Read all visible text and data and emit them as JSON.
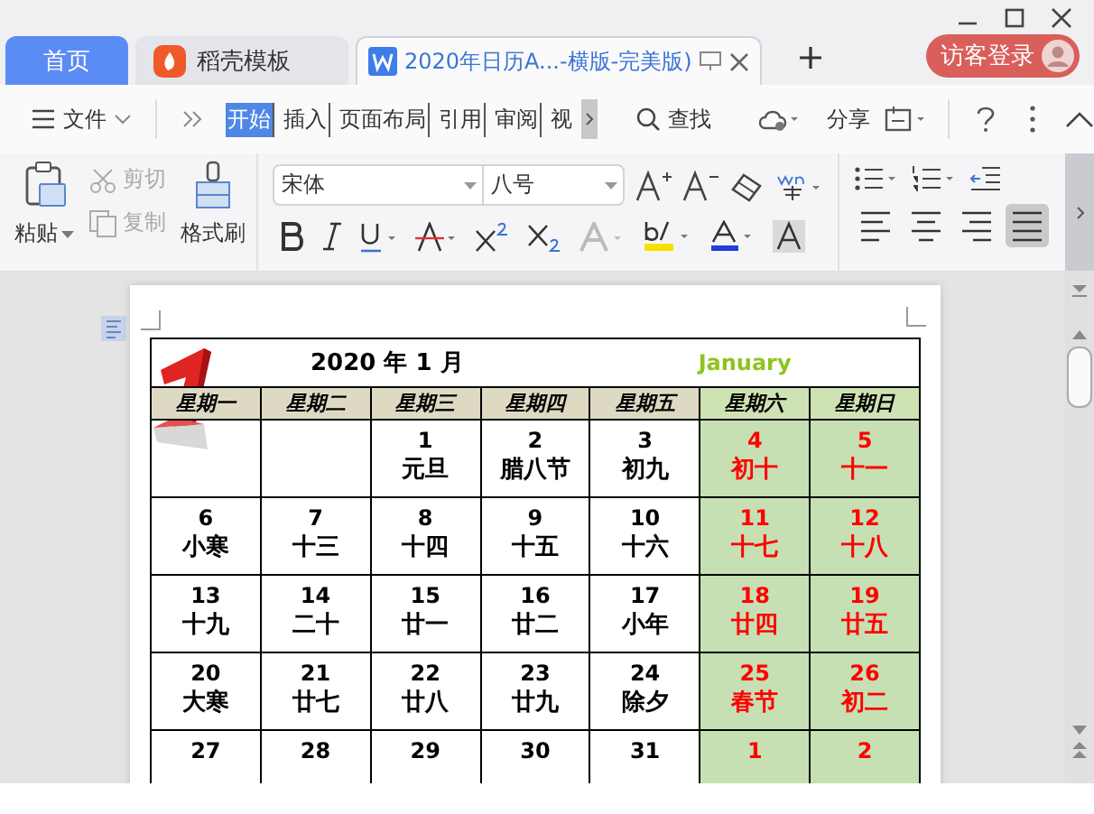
{
  "title_bar": {
    "tabs": [
      {
        "label": "首页",
        "kind": "home",
        "selected": false
      },
      {
        "label": "稻壳模板",
        "kind": "template",
        "selected": false
      },
      {
        "label": "2020年日历A...-横版-完美版)",
        "kind": "document",
        "selected": true
      }
    ],
    "login_button": "访客登录"
  },
  "menu_bar": {
    "file_menu": "文件",
    "ribbon_tabs": [
      {
        "label": "开始",
        "selected": true
      },
      {
        "label": "插入",
        "selected": false
      },
      {
        "label": "页面布局",
        "selected": false
      },
      {
        "label": "引用",
        "selected": false
      },
      {
        "label": "审阅",
        "selected": false
      },
      {
        "label": "视",
        "selected": false
      }
    ],
    "search": "查找",
    "share": "分享"
  },
  "ribbon": {
    "paste": "粘贴",
    "clipboard_actions": [
      {
        "label": "剪切",
        "kind": "cut",
        "disabled": true
      },
      {
        "label": "复制",
        "kind": "copy",
        "disabled": true
      }
    ],
    "format_painter": "格式刷",
    "font_name": "宋体",
    "font_size": "八号",
    "alignment_buttons": [
      {
        "kind": "left",
        "selected": false
      },
      {
        "kind": "center",
        "selected": false
      },
      {
        "kind": "right",
        "selected": false
      },
      {
        "kind": "justify",
        "selected": true
      }
    ]
  },
  "calendar": {
    "title": "2020 年 1 月",
    "english_month": "January",
    "weekdays": [
      {
        "label": "星期一",
        "weekend": false
      },
      {
        "label": "星期二",
        "weekend": false
      },
      {
        "label": "星期三",
        "weekend": false
      },
      {
        "label": "星期四",
        "weekend": false
      },
      {
        "label": "星期五",
        "weekend": false
      },
      {
        "label": "星期六",
        "weekend": true
      },
      {
        "label": "星期日",
        "weekend": true
      }
    ],
    "weeks": [
      {
        "days": [
          {
            "kind": "blank",
            "weekend": false
          },
          {
            "kind": "blank",
            "weekend": false
          },
          {
            "kind": "day",
            "date": "1",
            "lunar": "元旦",
            "weekend": false
          },
          {
            "kind": "day",
            "date": "2",
            "lunar": "腊八节",
            "weekend": false
          },
          {
            "kind": "day",
            "date": "3",
            "lunar": "初九",
            "weekend": false
          },
          {
            "kind": "day",
            "date": "4",
            "lunar": "初十",
            "weekend": true
          },
          {
            "kind": "day",
            "date": "5",
            "lunar": "十一",
            "weekend": true
          }
        ]
      },
      {
        "days": [
          {
            "kind": "day",
            "date": "6",
            "lunar": "小寒",
            "weekend": false
          },
          {
            "kind": "day",
            "date": "7",
            "lunar": "十三",
            "weekend": false
          },
          {
            "kind": "day",
            "date": "8",
            "lunar": "十四",
            "weekend": false
          },
          {
            "kind": "day",
            "date": "9",
            "lunar": "十五",
            "weekend": false
          },
          {
            "kind": "day",
            "date": "10",
            "lunar": "十六",
            "weekend": false
          },
          {
            "kind": "day",
            "date": "11",
            "lunar": "十七",
            "weekend": true
          },
          {
            "kind": "day",
            "date": "12",
            "lunar": "十八",
            "weekend": true
          }
        ]
      },
      {
        "days": [
          {
            "kind": "day",
            "date": "13",
            "lunar": "十九",
            "weekend": false
          },
          {
            "kind": "day",
            "date": "14",
            "lunar": "二十",
            "weekend": false
          },
          {
            "kind": "day",
            "date": "15",
            "lunar": "廿一",
            "weekend": false
          },
          {
            "kind": "day",
            "date": "16",
            "lunar": "廿二",
            "weekend": false
          },
          {
            "kind": "day",
            "date": "17",
            "lunar": "小年",
            "weekend": false
          },
          {
            "kind": "day",
            "date": "18",
            "lunar": "廿四",
            "weekend": true
          },
          {
            "kind": "day",
            "date": "19",
            "lunar": "廿五",
            "weekend": true
          }
        ]
      },
      {
        "days": [
          {
            "kind": "day",
            "date": "20",
            "lunar": "大寒",
            "weekend": false
          },
          {
            "kind": "day",
            "date": "21",
            "lunar": "廿七",
            "weekend": false
          },
          {
            "kind": "day",
            "date": "22",
            "lunar": "廿八",
            "weekend": false
          },
          {
            "kind": "day",
            "date": "23",
            "lunar": "廿九",
            "weekend": false
          },
          {
            "kind": "day",
            "date": "24",
            "lunar": "除夕",
            "weekend": false
          },
          {
            "kind": "day",
            "date": "25",
            "lunar": "春节",
            "weekend": true
          },
          {
            "kind": "day",
            "date": "26",
            "lunar": "初二",
            "weekend": true
          }
        ]
      },
      {
        "days": [
          {
            "kind": "day",
            "date": "27",
            "weekend": false
          },
          {
            "kind": "day",
            "date": "28",
            "weekend": false
          },
          {
            "kind": "day",
            "date": "29",
            "weekend": false
          },
          {
            "kind": "day",
            "date": "30",
            "weekend": false
          },
          {
            "kind": "day",
            "date": "31",
            "weekend": false
          },
          {
            "kind": "day",
            "date": "1",
            "weekend": true
          },
          {
            "kind": "day",
            "date": "2",
            "weekend": true
          }
        ]
      }
    ]
  }
}
